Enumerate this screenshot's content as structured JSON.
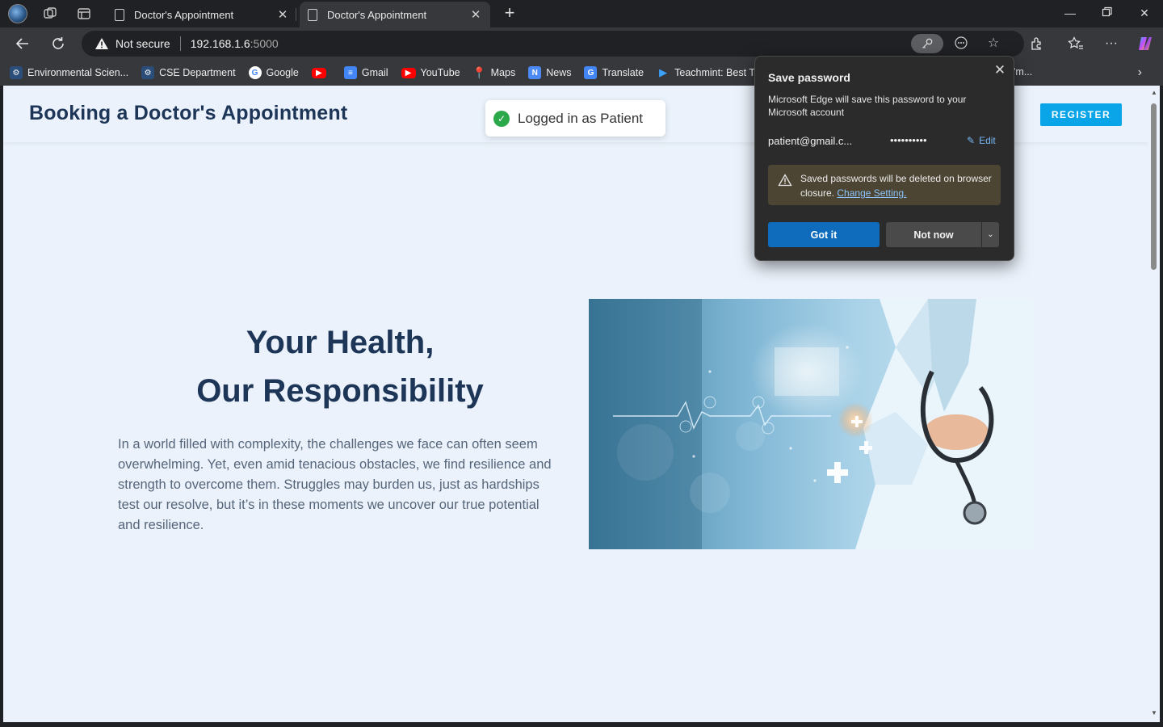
{
  "browser": {
    "tabs": [
      {
        "title": "Doctor's Appointment",
        "active": false
      },
      {
        "title": "Doctor's Appointment",
        "active": true
      }
    ],
    "address": {
      "security_label": "Not secure",
      "host": "192.168.1.6",
      "port": ":5000"
    },
    "bookmarks": [
      {
        "label": "Environmental Scien...",
        "icon": "sci-icon",
        "color": "#c77a2a"
      },
      {
        "label": "CSE Department",
        "icon": "sci-icon",
        "color": "#c77a2a"
      },
      {
        "label": "Google",
        "icon": "google-icon",
        "color": "#ffffff"
      },
      {
        "label": "",
        "icon": "youtube-icon",
        "color": "#ff0000"
      },
      {
        "label": "Gmail",
        "icon": "docs-icon",
        "color": "#4285f4"
      },
      {
        "label": "YouTube",
        "icon": "youtube-icon",
        "color": "#ff0000"
      },
      {
        "label": "Maps",
        "icon": "maps-icon",
        "color": "#34a853"
      },
      {
        "label": "News",
        "icon": "news-icon",
        "color": "#4c8bf5"
      },
      {
        "label": "Translate",
        "icon": "translate-icon",
        "color": "#4285f4"
      },
      {
        "label": "Teachmint: Best Tea...",
        "icon": "teachmint-icon",
        "color": "#1a73e8"
      }
    ],
    "bookmark_overflow_text": "'m..."
  },
  "site": {
    "title": "Booking a Doctor's Appointment",
    "toast": "Logged in as Patient",
    "register_label": "REGISTER",
    "hero": {
      "title_line1": "Your Health,",
      "title_line2": "Our Responsibility",
      "text": "In a world filled with complexity, the challenges we face can often seem overwhelming. Yet, even amid tenacious obstacles, we find resilience and strength to overcome them. Struggles may burden us, just as hardships test our resolve, but it’s in these moments we uncover our true potential and resilience."
    }
  },
  "save_password": {
    "title": "Save password",
    "description": "Microsoft Edge will save this password to your Microsoft account",
    "username": "patient@gmail.c...",
    "password_mask": "••••••••••",
    "edit_label": "Edit",
    "warning_text": "Saved passwords will be deleted on browser closure.",
    "warning_link": "Change Setting.",
    "primary_button": "Got it",
    "secondary_button": "Not now"
  },
  "colors": {
    "brand_navy": "#1d3557",
    "register_blue": "#0aa5e8",
    "toast_check_green": "#2aa84a",
    "edge_primary": "#0f6cbd"
  }
}
